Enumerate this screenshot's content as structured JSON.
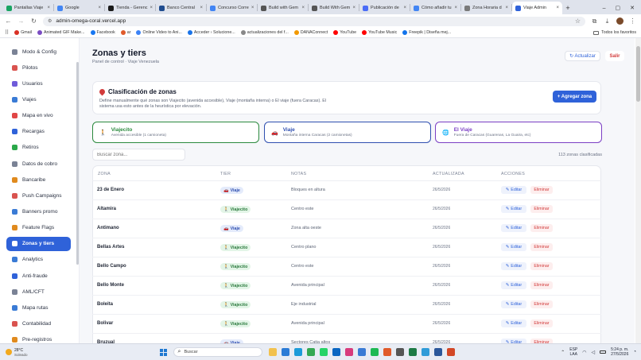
{
  "browser": {
    "tabs": [
      {
        "label": "Pantallas Viaje",
        "color": "#19a463"
      },
      {
        "label": "Google",
        "color": "#4285f4"
      },
      {
        "label": "Tienda - Gerenc",
        "color": "#1a1a1a"
      },
      {
        "label": "Banco Central",
        "color": "#1f4c8f"
      },
      {
        "label": "Concurso Corre",
        "color": "#4285f4"
      },
      {
        "label": "Build with Gem",
        "color": "#555555"
      },
      {
        "label": "Build With Gem",
        "color": "#555555"
      },
      {
        "label": "Publicación de",
        "color": "#4a6cf7"
      },
      {
        "label": "Cómo añadir tu",
        "color": "#4285f4"
      },
      {
        "label": "Zona Horaria d",
        "color": "#7a7a7a"
      },
      {
        "label": "Viaje Admin",
        "color": "#2f62d9"
      }
    ],
    "new_tab": "+",
    "url": "admin-omega-coral.vercel.app",
    "bookmarks": [
      {
        "label": "Gmail",
        "color": "#d93025"
      },
      {
        "label": "Animated GIF Make...",
        "color": "#7a4cc2"
      },
      {
        "label": "Facebook",
        "color": "#1877f2"
      },
      {
        "label": "ar",
        "color": "#e05a2a"
      },
      {
        "label": "Online Video to Ani...",
        "color": "#3b82f6"
      },
      {
        "label": "Acceder › Solucione...",
        "color": "#1a73e8"
      },
      {
        "label": "actualizaciones del f...",
        "color": "#888888"
      },
      {
        "label": "DANAConnect",
        "color": "#f29900"
      },
      {
        "label": "YouTube",
        "color": "#ff0000"
      },
      {
        "label": "YouTube Music",
        "color": "#ff0000"
      },
      {
        "label": "Freepik | Diseña mej...",
        "color": "#1273eb"
      }
    ],
    "all_bookmarks": "Todos los favoritos"
  },
  "sidebar": {
    "items": [
      {
        "label": "Modo & Config",
        "color": "#7a8295"
      },
      {
        "label": "Pilotos",
        "color": "#d9534f"
      },
      {
        "label": "Usuarios",
        "color": "#6f5bd9"
      },
      {
        "label": "Viajes",
        "color": "#3a7bd5"
      },
      {
        "label": "Mapa en vivo",
        "color": "#e04646"
      },
      {
        "label": "Recargas",
        "color": "#2f62d9"
      },
      {
        "label": "Retiros",
        "color": "#2ba84a"
      },
      {
        "label": "Datos de cobro",
        "color": "#7a8295"
      },
      {
        "label": "Bancaribe",
        "color": "#e08a1e"
      },
      {
        "label": "Push Campaigns",
        "color": "#d9534f"
      },
      {
        "label": "Banners promo",
        "color": "#3a7bd5"
      },
      {
        "label": "Feature Flags",
        "color": "#e08a1e"
      },
      {
        "label": "Zonas y tiers",
        "color": "#ffffff"
      },
      {
        "label": "Analytics",
        "color": "#3a7bd5"
      },
      {
        "label": "Anti-fraude",
        "color": "#2f62d9"
      },
      {
        "label": "AML/CFT",
        "color": "#7a8295"
      },
      {
        "label": "Mapa rutas",
        "color": "#3a7bd5"
      },
      {
        "label": "Contabilidad",
        "color": "#d9534f"
      },
      {
        "label": "Pre-registros",
        "color": "#e08a1e"
      }
    ],
    "active_index": 12
  },
  "header": {
    "title": "Zonas y tiers",
    "subtitle": "Panel de control · Viaje Venezuela",
    "refresh_label": "↻ Actualizar",
    "logout_label": "Salir"
  },
  "classification": {
    "title": "Clasificación de zonas",
    "description": "Define manualmente qué zonas son Viajecito (avenida accesible), Viaje (montaña interna) o El viaje (fuera Caracas). El sistema usa esto antes de la heurística por elevación.",
    "add_label": "+ Agregar zona"
  },
  "tiers": [
    {
      "name": "Viajecito",
      "desc": "Avenida accesible (1 camioneta)",
      "color": "#2b8a3e"
    },
    {
      "name": "Viaje",
      "desc": "Montaña interna Caracas (2 camionetas)",
      "color": "#2f4fb0"
    },
    {
      "name": "El Viaje",
      "desc": "Fuera de Caracas (Guarenas, La Guaira, etc)",
      "color": "#7b3fc4"
    }
  ],
  "search": {
    "placeholder": "Buscar zona..."
  },
  "count_label": "113 zonas clasificadas",
  "table": {
    "headers": [
      "ZONA",
      "TIER",
      "NOTAS",
      "ACTUALIZADA",
      "ACCIONES"
    ],
    "edit_label": "Editar",
    "delete_label": "Eliminar",
    "rows": [
      {
        "zona": "23 de Enero",
        "tier": "Viaje",
        "notas": "Bloques en altura",
        "fecha": "26/5/2026"
      },
      {
        "zona": "Altamira",
        "tier": "Viajecito",
        "notas": "Centro este",
        "fecha": "26/5/2026"
      },
      {
        "zona": "Antimano",
        "tier": "Viaje",
        "notas": "Zona alta oeste",
        "fecha": "26/5/2026"
      },
      {
        "zona": "Bellas Artes",
        "tier": "Viajecito",
        "notas": "Centro plano",
        "fecha": "26/5/2026"
      },
      {
        "zona": "Bello Campo",
        "tier": "Viajecito",
        "notas": "Centro este",
        "fecha": "26/5/2026"
      },
      {
        "zona": "Bello Monte",
        "tier": "Viajecito",
        "notas": "Avenida principal",
        "fecha": "26/5/2026"
      },
      {
        "zona": "Boleita",
        "tier": "Viajecito",
        "notas": "Eje industrial",
        "fecha": "26/5/2026"
      },
      {
        "zona": "Bolivar",
        "tier": "Viajecito",
        "notas": "Avenida principal",
        "fecha": "26/5/2026"
      },
      {
        "zona": "Bruzual",
        "tier": "Viaje",
        "notas": "Sectores Catia altos",
        "fecha": "26/5/2026"
      }
    ]
  },
  "taskbar": {
    "weather_temp": "28°C",
    "weather_desc": "Soleado",
    "search_placeholder": "Buscar",
    "lang": "ESP",
    "lang_sub": "LAA",
    "time": "5:24 p. m.",
    "date": "27/5/2026"
  }
}
